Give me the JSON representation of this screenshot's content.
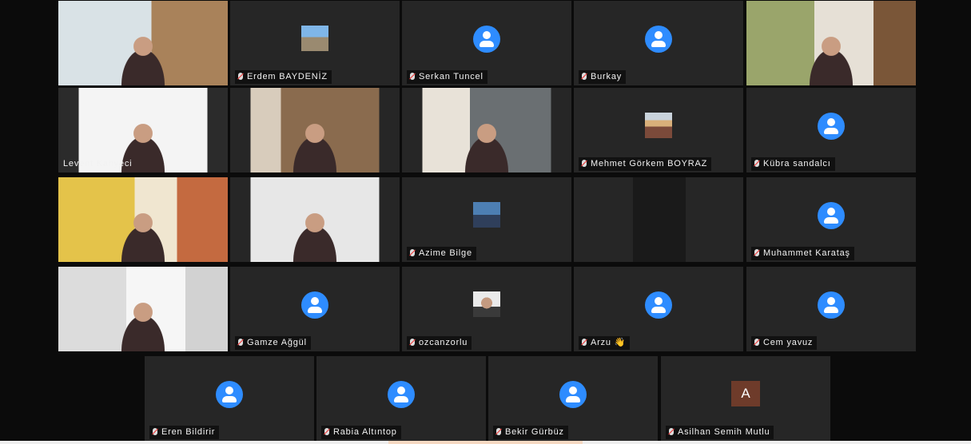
{
  "participants": [
    {
      "name": "",
      "tile": "video"
    },
    {
      "name": "Erdem BAYDENİZ",
      "tile": "thumbnail"
    },
    {
      "name": "Serkan Tuncel",
      "tile": "avatar"
    },
    {
      "name": "Burkay",
      "tile": "avatar"
    },
    {
      "name": "",
      "tile": "video"
    },
    {
      "name": "Levent Kahyeci",
      "tile": "video"
    },
    {
      "name": "",
      "tile": "video"
    },
    {
      "name": "",
      "tile": "video"
    },
    {
      "name": "Mehmet Görkem BOYRAZ",
      "tile": "thumbnail"
    },
    {
      "name": "Kübra sandalcı",
      "tile": "avatar"
    },
    {
      "name": "",
      "tile": "video"
    },
    {
      "name": "",
      "tile": "video"
    },
    {
      "name": "Azime Bilge",
      "tile": "thumbnail"
    },
    {
      "name": "",
      "tile": "video"
    },
    {
      "name": "Muhammet Karataş",
      "tile": "avatar"
    },
    {
      "name": "",
      "tile": "video"
    },
    {
      "name": "Gamze Ağgül",
      "tile": "avatar"
    },
    {
      "name": "ozcanzorlu",
      "tile": "thumbnail"
    },
    {
      "name": "Arzu 👋",
      "tile": "avatar"
    },
    {
      "name": "Cem yavuz",
      "tile": "avatar"
    },
    {
      "name": "Eren Bildirir",
      "tile": "avatar"
    },
    {
      "name": "Rabia Altıntop",
      "tile": "avatar"
    },
    {
      "name": "Bekir Gürbüz",
      "tile": "avatar"
    },
    {
      "name": "Asilhan Semih Mutlu",
      "tile": "letter",
      "letter": "A"
    }
  ],
  "colors": {
    "background": "#0b0b0b",
    "tile": "#262626",
    "avatar_blue": "#2e8cff",
    "letter_avatar": "#6e3b2a"
  }
}
